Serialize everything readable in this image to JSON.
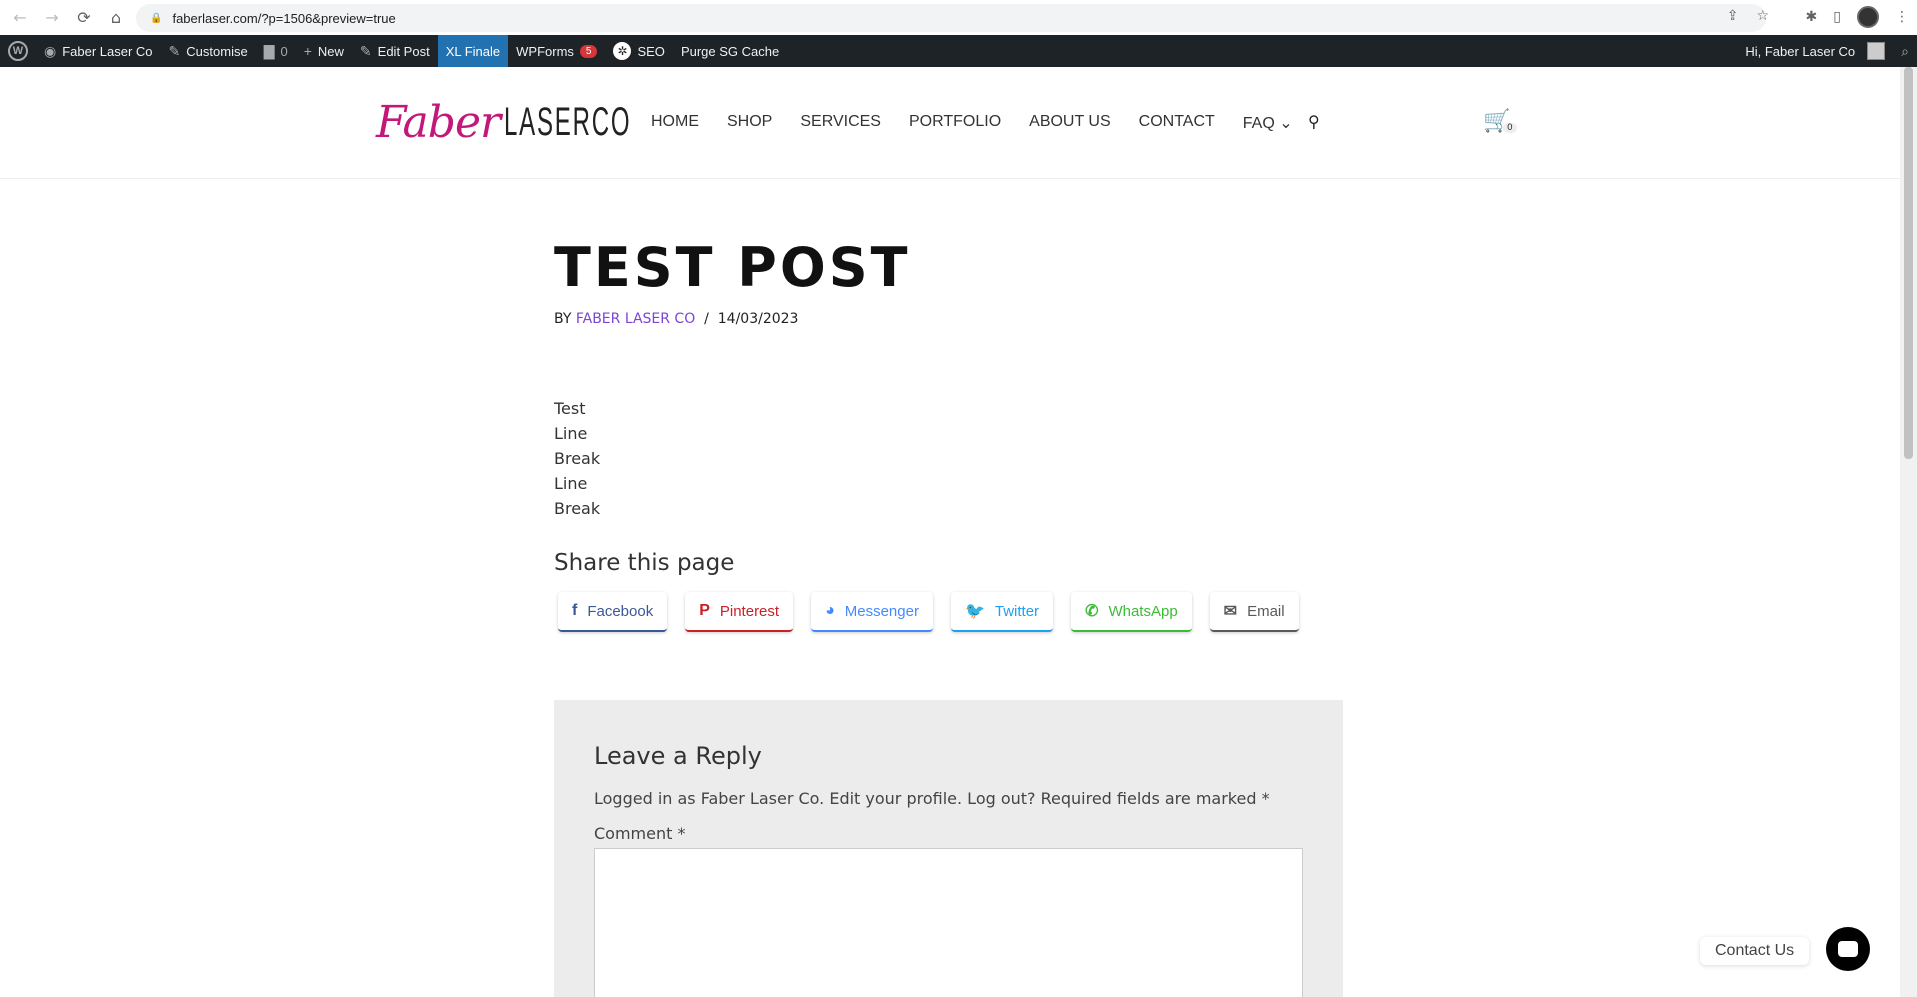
{
  "browser": {
    "url": "faberlaser.com/?p=1506&preview=true",
    "back_icon": "←",
    "forward_icon": "→",
    "reload_icon": "⟳",
    "home_icon": "⌂",
    "lock_icon": "🔒",
    "share_icon": "⇪",
    "star_icon": "☆",
    "extensions_icon": "✱",
    "sidepanel_icon": "▯",
    "menu_icon": "⋮"
  },
  "wpbar": {
    "logo": "W",
    "site_name": "Faber Laser Co",
    "customise": "Customise",
    "comments_count": "0",
    "new": "New",
    "edit_post": "Edit Post",
    "xl_finale": "XL Finale",
    "wpforms": "WPForms",
    "wpforms_badge": "5",
    "seo": "SEO",
    "purge": "Purge SG Cache",
    "greeting": "Hi, Faber Laser Co",
    "search_icon": "⌕",
    "site_icon": "◉",
    "brush_icon": "✎",
    "comment_icon": "▇",
    "plus_icon": "+",
    "pencil_icon": "✎",
    "gear_icon": "✲"
  },
  "header": {
    "logo_script": "Faber",
    "logo_caps": "LASERCO",
    "nav": [
      "HOME",
      "SHOP",
      "SERVICES",
      "PORTFOLIO",
      "ABOUT US",
      "CONTACT",
      "FAQ ⌄"
    ],
    "search_icon": "⚲",
    "cart_icon": "🛒",
    "cart_count": "0"
  },
  "post": {
    "title": "TEST POST",
    "by": "BY",
    "author": "FABER LASER CO",
    "separator": "/",
    "date": "14/03/2023",
    "body": [
      "Test",
      "Line",
      "Break",
      "Line",
      "Break"
    ]
  },
  "share": {
    "title": "Share this page",
    "buttons": [
      {
        "label": "Facebook",
        "icon": "f",
        "color": "#3b5998"
      },
      {
        "label": "Pinterest",
        "icon": "P",
        "color": "#cb2027"
      },
      {
        "label": "Messenger",
        "icon": "◕",
        "color": "#448aff"
      },
      {
        "label": "Twitter",
        "icon": "🐦",
        "color": "#1da1f2"
      },
      {
        "label": "WhatsApp",
        "icon": "✆",
        "color": "#3cbc37"
      },
      {
        "label": "Email",
        "icon": "✉",
        "color": "#595959"
      }
    ]
  },
  "reply": {
    "title": "Leave a Reply",
    "logged_in": "Logged in as Faber Laser Co. Edit your profile. Log out? Required fields are marked *",
    "comment_label": "Comment *"
  },
  "contact_widget": {
    "label": "Contact Us"
  }
}
